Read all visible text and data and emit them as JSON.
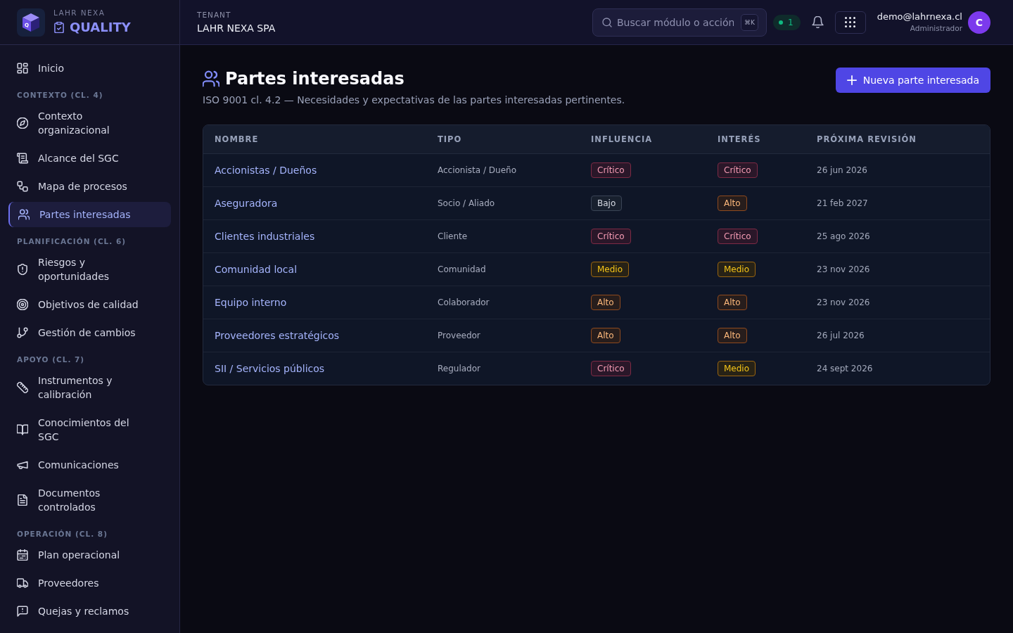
{
  "sidebar": {
    "brand": {
      "mark": "Q",
      "company": "LAHR NEXA",
      "product": "QUALITY"
    },
    "items": [
      {
        "label": "Inicio",
        "selected": false
      }
    ],
    "sections": [
      {
        "title": "CONTEXTO (CL. 4)",
        "items": [
          {
            "label": "Contexto organizacional",
            "selected": false
          },
          {
            "label": "Alcance del SGC",
            "selected": false
          },
          {
            "label": "Mapa de procesos",
            "selected": false
          },
          {
            "label": "Partes interesadas",
            "selected": true
          }
        ]
      },
      {
        "title": "PLANIFICACIÓN (CL. 6)",
        "items": [
          {
            "label": "Riesgos y oportunidades",
            "selected": false
          },
          {
            "label": "Objetivos de calidad",
            "selected": false
          },
          {
            "label": "Gestión de cambios",
            "selected": false
          }
        ]
      },
      {
        "title": "APOYO (CL. 7)",
        "items": [
          {
            "label": "Instrumentos y calibración",
            "selected": false
          },
          {
            "label": "Conocimientos del SGC",
            "selected": false
          },
          {
            "label": "Comunicaciones",
            "selected": false
          },
          {
            "label": "Documentos controlados",
            "selected": false
          }
        ]
      },
      {
        "title": "OPERACIÓN (CL. 8)",
        "items": [
          {
            "label": "Plan operacional",
            "selected": false
          },
          {
            "label": "Proveedores",
            "selected": false
          },
          {
            "label": "Quejas y reclamos",
            "selected": false
          }
        ]
      }
    ]
  },
  "topbar": {
    "tenant_label": "TENANT",
    "tenant": "LAHR NEXA SPA",
    "search": {
      "placeholder": "Buscar módulo o acción",
      "shortcut": "⌘K"
    },
    "status_count": "1",
    "user": {
      "email": "demo@lahrnexa.cl",
      "role": "Administrador",
      "initial": "C"
    }
  },
  "page": {
    "title": "Partes interesadas",
    "subtitle": "ISO 9001 cl. 4.2 — Necesidades y expectativas de las partes interesadas pertinentes.",
    "primary_button": "Nueva parte interesada"
  },
  "table": {
    "columns": [
      "NOMBRE",
      "TIPO",
      "INFLUENCIA",
      "INTERÉS",
      "PRÓXIMA REVISIÓN"
    ],
    "rows": [
      {
        "name": "Accionistas / Dueños",
        "type": "Accionista / Dueño",
        "influence": {
          "label": "Crítico",
          "kind": "critical"
        },
        "interest": {
          "label": "Crítico",
          "kind": "critical"
        },
        "next_review": "26 jun 2026"
      },
      {
        "name": "Aseguradora",
        "type": "Socio / Aliado",
        "influence": {
          "label": "Bajo",
          "kind": "low"
        },
        "interest": {
          "label": "Alto",
          "kind": "high"
        },
        "next_review": "21 feb 2027"
      },
      {
        "name": "Clientes industriales",
        "type": "Cliente",
        "influence": {
          "label": "Crítico",
          "kind": "critical"
        },
        "interest": {
          "label": "Crítico",
          "kind": "critical"
        },
        "next_review": "25 ago 2026"
      },
      {
        "name": "Comunidad local",
        "type": "Comunidad",
        "influence": {
          "label": "Medio",
          "kind": "medium"
        },
        "interest": {
          "label": "Medio",
          "kind": "medium"
        },
        "next_review": "23 nov 2026"
      },
      {
        "name": "Equipo interno",
        "type": "Colaborador",
        "influence": {
          "label": "Alto",
          "kind": "high"
        },
        "interest": {
          "label": "Alto",
          "kind": "high"
        },
        "next_review": "23 nov 2026"
      },
      {
        "name": "Proveedores estratégicos",
        "type": "Proveedor",
        "influence": {
          "label": "Alto",
          "kind": "high"
        },
        "interest": {
          "label": "Alto",
          "kind": "high"
        },
        "next_review": "26 jul 2026"
      },
      {
        "name": "SII / Servicios públicos",
        "type": "Regulador",
        "influence": {
          "label": "Crítico",
          "kind": "critical"
        },
        "interest": {
          "label": "Medio",
          "kind": "medium"
        },
        "next_review": "24 sept 2026"
      }
    ]
  }
}
